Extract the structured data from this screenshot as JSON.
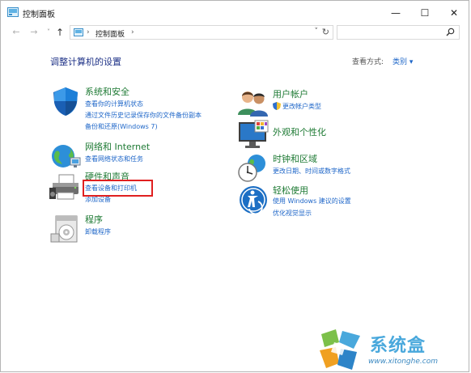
{
  "window": {
    "title": "控制面板",
    "min_glyph": "—",
    "max_glyph": "☐",
    "close_glyph": "✕"
  },
  "address": {
    "back_glyph": "←",
    "forward_glyph": "→",
    "recent_glyph": "˅",
    "up_glyph": "↑",
    "sep": "›",
    "crumb": "控制面板",
    "dropdown_glyph": "˅",
    "refresh_glyph": "↻",
    "search_placeholder": ""
  },
  "main": {
    "heading": "调整计算机的设置",
    "view_by_label": "查看方式:",
    "view_by_value": "类别 ▾"
  },
  "categories_left": [
    {
      "title": "系统和安全",
      "icon": "shield-icon",
      "links": [
        "查看你的计算机状态",
        "通过文件历史记录保存你的文件备份副本",
        "备份和还原(Windows 7)"
      ]
    },
    {
      "title": "网络和 Internet",
      "icon": "globe-network-icon",
      "links": [
        "查看网络状态和任务"
      ]
    },
    {
      "title": "硬件和声音",
      "icon": "printer-icon",
      "links": [
        "查看设备和打印机",
        "添加设备"
      ]
    },
    {
      "title": "程序",
      "icon": "programs-disc-icon",
      "links": [
        "卸载程序"
      ]
    }
  ],
  "categories_right": [
    {
      "title": "用户帐户",
      "icon": "users-icon",
      "links": [
        "更改帐户类型"
      ]
    },
    {
      "title": "外观和个性化",
      "icon": "monitor-appearance-icon",
      "links": []
    },
    {
      "title": "时钟和区域",
      "icon": "clock-globe-icon",
      "links": [
        "更改日期、时间或数字格式"
      ]
    },
    {
      "title": "轻松使用",
      "icon": "ease-of-access-icon",
      "links": [
        "使用 Windows 建议的设置",
        "优化视觉显示"
      ]
    }
  ],
  "watermark": {
    "name": "系统盒",
    "url": "www.xitonghe.com"
  },
  "colors": {
    "category_title": "#1e7a34",
    "link": "#1e66c8",
    "heading": "#1e3287",
    "highlight": "#e02020"
  }
}
